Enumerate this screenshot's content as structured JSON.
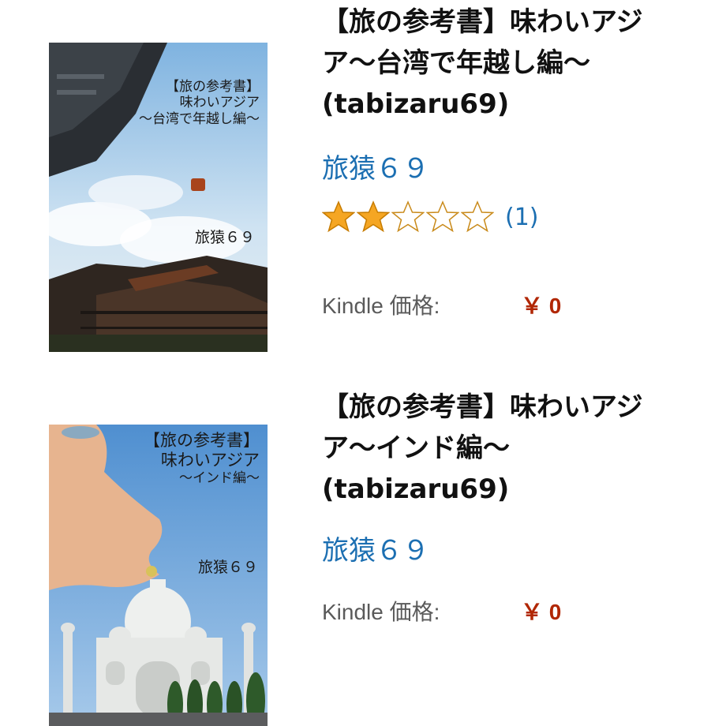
{
  "items": [
    {
      "title_line1": "【旅の参考書】味わいアジ",
      "title_line2": "ア～台湾で年越し編～",
      "title_line3": "(tabizaru69)",
      "author": "旅猿６９",
      "rating": 2,
      "rating_max": 5,
      "review_count": "(1)",
      "price_label": "Kindle 価格:",
      "price": "￥ 0",
      "cover": {
        "line1": "【旅の参考書】",
        "line2": "味わいアジア",
        "line3": "～台湾で年越し編～",
        "author": "旅猿６９"
      }
    },
    {
      "title_line1": "【旅の参考書】味わいアジ",
      "title_line2": "ア～インド編～",
      "title_line3": "(tabizaru69)",
      "author": "旅猿６９",
      "price_label": "Kindle 価格:",
      "price": "￥ 0",
      "cover": {
        "line1": "【旅の参考書】",
        "line2": "味わいアジア",
        "line3": "～インド編～",
        "author": "旅猿６９"
      }
    }
  ],
  "colors": {
    "link": "#1c6fb2",
    "price": "#b12704",
    "star_filled": "#f5a623"
  }
}
